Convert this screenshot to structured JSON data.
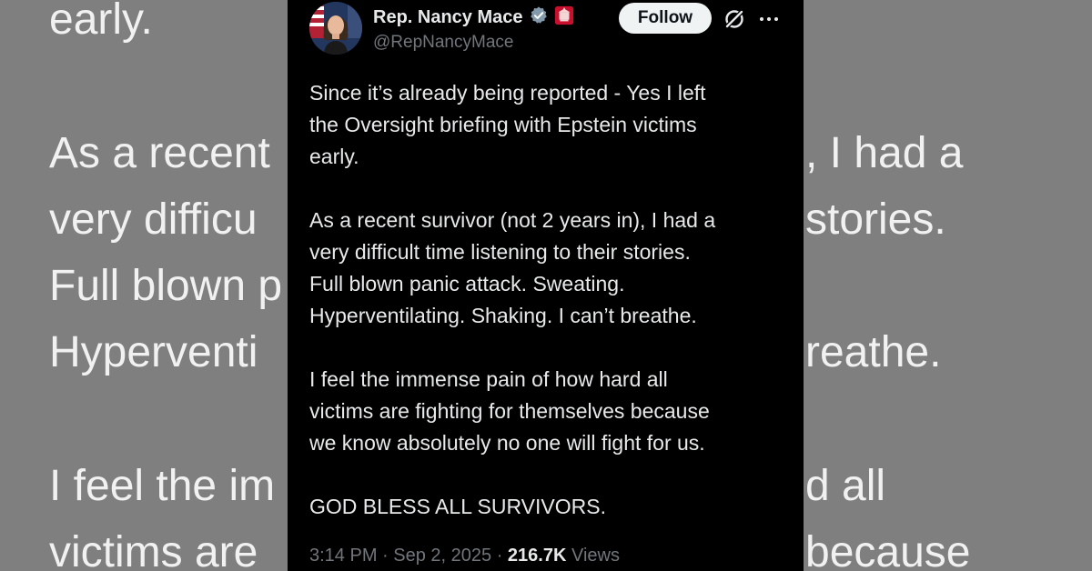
{
  "background": {
    "lines": [
      "early.",
      "As a recent",
      ", I had a",
      "very difficu",
      "stories.",
      "Full blown p",
      "Hyperventi",
      "reathe.",
      "I feel the im",
      "d all",
      "victims are",
      "because"
    ]
  },
  "author": {
    "name": "Rep. Nancy Mace",
    "handle": "@RepNancyMace",
    "verified_icon": "verified-badge-icon",
    "affiliation_icon": "government-seal-icon"
  },
  "actions": {
    "follow_label": "Follow",
    "grok_icon": "grok-icon",
    "more_icon": "more-options-icon"
  },
  "tweet": {
    "paragraphs": [
      "Since it’s already being reported - Yes I left\nthe Oversight briefing with Epstein victims\nearly.",
      "As a recent survivor (not 2 years in), I had a\nvery difficult time listening to their stories.\nFull blown panic attack. Sweating.\nHyperventilating. Shaking. I can’t breathe.",
      "I feel the immense pain of how hard all\nvictims are fighting for themselves because\nwe know absolutely no one will fight for us.",
      "GOD BLESS ALL SURVIVORS."
    ],
    "time": "3:14 PM",
    "date": "Sep 2, 2025",
    "views_count": "216.7K",
    "views_label": "Views"
  },
  "colors": {
    "background_gray": "#7f7f7f",
    "card_black": "#000000",
    "text_primary": "#e7e9ea",
    "text_secondary": "#71767b",
    "verified_blue": "#1d9bf0"
  }
}
